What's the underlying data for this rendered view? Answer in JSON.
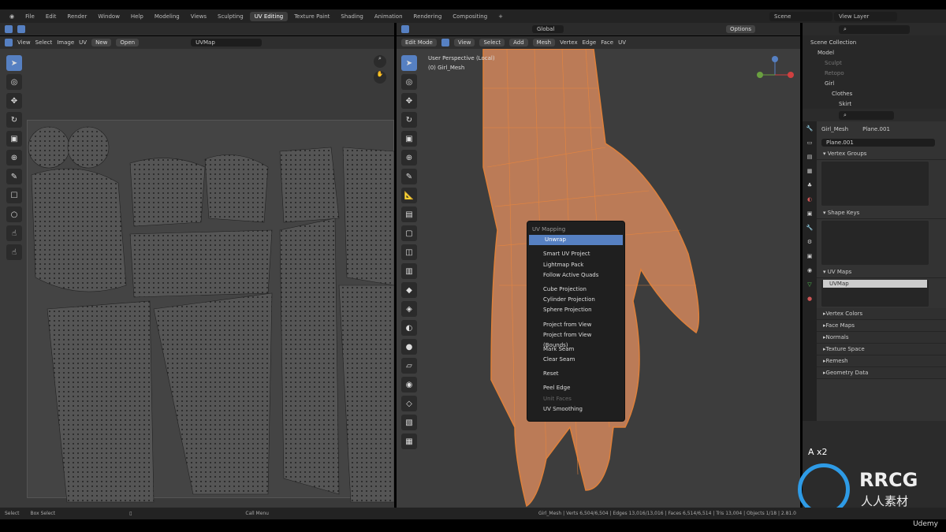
{
  "top_menu": {
    "items": [
      "File",
      "Edit",
      "Render",
      "Window",
      "Help"
    ],
    "workspaces": [
      "Modeling",
      "Views",
      "Sculpting",
      "UV Editing",
      "Texture Paint",
      "Shading",
      "Animation",
      "Rendering",
      "Compositing",
      "+"
    ],
    "active": "UV Editing",
    "scene": "Scene",
    "view_layer": "View Layer"
  },
  "uv_editor": {
    "menus": [
      "View",
      "Select",
      "Image",
      "UV"
    ],
    "new_label": "New",
    "open_label": "Open",
    "uv_map": "UVMap"
  },
  "viewport": {
    "mode": "Edit Mode",
    "menus": [
      "View",
      "Select",
      "Add",
      "Mesh",
      "Vertex",
      "Edge",
      "Face",
      "UV"
    ],
    "orientation": "Global",
    "options": "Options",
    "overlay_title": "User Perspective (Local)",
    "overlay_object": "(0) Girl_Mesh"
  },
  "uv_menu": {
    "title": "UV Mapping",
    "items": [
      {
        "label": "Unwrap",
        "highlight": true
      },
      {
        "sep": true
      },
      {
        "label": "Smart UV Project"
      },
      {
        "label": "Lightmap Pack"
      },
      {
        "label": "Follow Active Quads"
      },
      {
        "sep": true
      },
      {
        "label": "Cube Projection"
      },
      {
        "label": "Cylinder Projection"
      },
      {
        "label": "Sphere Projection"
      },
      {
        "sep": true
      },
      {
        "label": "Project from View"
      },
      {
        "label": "Project from View (Bounds)"
      },
      {
        "sep": true
      },
      {
        "label": "Mark Seam"
      },
      {
        "label": "Clear Seam"
      },
      {
        "sep": true
      },
      {
        "label": "Reset"
      },
      {
        "sep": true
      },
      {
        "label": "Peel Edge"
      },
      {
        "label": "Unit Faces",
        "disabled": true
      },
      {
        "label": "UV Smoothing"
      }
    ]
  },
  "outliner": {
    "items": [
      {
        "label": "Scene Collection",
        "depth": 0
      },
      {
        "label": "Model",
        "depth": 1
      },
      {
        "label": "Sculpt",
        "depth": 2,
        "dim": true
      },
      {
        "label": "Retopo",
        "depth": 2,
        "dim": true
      },
      {
        "label": "Girl",
        "depth": 2
      },
      {
        "label": "Clothes",
        "depth": 3
      },
      {
        "label": "Skirt",
        "depth": 4
      }
    ]
  },
  "properties": {
    "object": "Girl_Mesh",
    "mesh": "Plane.001",
    "mesh_field": "Plane.001",
    "panels": [
      "Vertex Groups",
      "Shape Keys",
      "UV Maps"
    ],
    "uv_map_item": "UVMap",
    "collapsed": [
      "Vertex Colors",
      "Face Maps",
      "Normals",
      "Texture Space",
      "Remesh",
      "Geometry Data"
    ]
  },
  "status": {
    "left": [
      "Select",
      "Box Select",
      "",
      "Call Menu"
    ],
    "right": "Girl_Mesh | Verts 6,504/6,504 | Edges 13,016/13,016 | Faces 6,514/6,514 | Tris 13,004 | Objects 1/18 | 2.81.0"
  },
  "overlay": {
    "repeat": "A x2",
    "watermark": "RRCG",
    "watermark_cn": "人人素材",
    "udemy": "Udemy"
  },
  "colors": {
    "accent": "#5680c2",
    "mesh": "#f0883a"
  }
}
